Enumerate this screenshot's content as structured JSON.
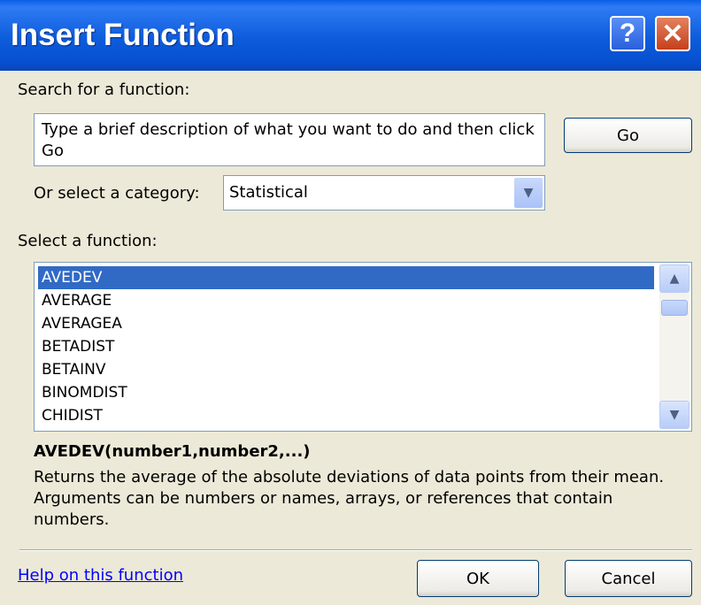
{
  "window": {
    "title": "Insert Function",
    "help_button": "?",
    "close_button": "✕"
  },
  "search": {
    "label": "Search for a function:",
    "value": "Type a brief description of what you want to do and then click Go",
    "go_button": "Go"
  },
  "category": {
    "label": "Or select a category:",
    "selected": "Statistical"
  },
  "functions": {
    "label": "Select a function:",
    "items": [
      "AVEDEV",
      "AVERAGE",
      "AVERAGEA",
      "BETADIST",
      "BETAINV",
      "BINOMDIST",
      "CHIDIST"
    ],
    "selected_index": 0
  },
  "details": {
    "signature": "AVEDEV(number1,number2,...)",
    "description": "Returns the average of the absolute deviations of data points from their mean. Arguments can be numbers or names, arrays, or references that contain numbers."
  },
  "footer": {
    "help_link": "Help on this function",
    "ok_button": "OK",
    "cancel_button": "Cancel"
  },
  "icons": {
    "scroll_up": "chevron-up-icon",
    "scroll_down": "chevron-down-icon",
    "dropdown": "chevron-down-icon"
  },
  "colors": {
    "titlebar": "#0A5FE6",
    "selection": "#316AC5",
    "link": "#0000FF",
    "dialog_bg": "#ECE9D8"
  }
}
